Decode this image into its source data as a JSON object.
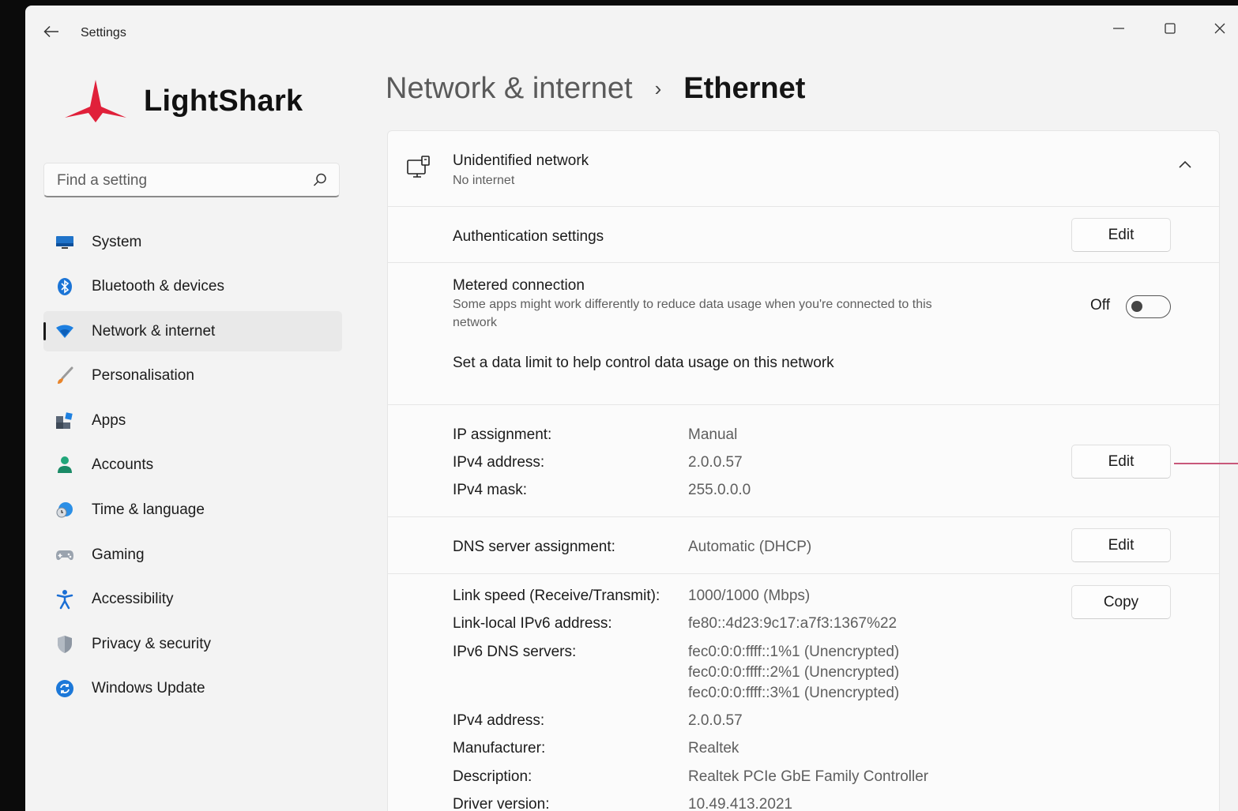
{
  "window": {
    "title": "Settings"
  },
  "brand": {
    "name": "LightShark",
    "color": "#e0203a"
  },
  "search": {
    "placeholder": "Find a setting"
  },
  "nav": {
    "items": [
      {
        "label": "System",
        "icon": "monitor-icon"
      },
      {
        "label": "Bluetooth & devices",
        "icon": "bluetooth-icon"
      },
      {
        "label": "Network & internet",
        "icon": "wifi-icon",
        "active": true
      },
      {
        "label": "Personalisation",
        "icon": "brush-icon"
      },
      {
        "label": "Apps",
        "icon": "apps-icon"
      },
      {
        "label": "Accounts",
        "icon": "person-icon"
      },
      {
        "label": "Time & language",
        "icon": "clock-globe-icon"
      },
      {
        "label": "Gaming",
        "icon": "gamepad-icon"
      },
      {
        "label": "Accessibility",
        "icon": "accessibility-icon"
      },
      {
        "label": "Privacy & security",
        "icon": "shield-icon"
      },
      {
        "label": "Windows Update",
        "icon": "refresh-icon"
      }
    ]
  },
  "header": {
    "parent": "Network & internet",
    "separator": "›",
    "current": "Ethernet"
  },
  "network": {
    "name": "Unidentified network",
    "status": "No internet"
  },
  "auth": {
    "label": "Authentication settings",
    "button": "Edit"
  },
  "metered": {
    "title": "Metered connection",
    "description_line1": "Some apps might work differently to reduce data usage when you're connected to this",
    "description_line2": "network",
    "toggle_label": "Off",
    "toggle_on": false,
    "data_limit_link": "Set a data limit to help control data usage on this network"
  },
  "ip": {
    "assignment_label": "IP assignment:",
    "assignment_value": "Manual",
    "ipv4_label": "IPv4 address:",
    "ipv4_value": "2.0.0.57",
    "mask_label": "IPv4 mask:",
    "mask_value": "255.0.0.0",
    "button": "Edit"
  },
  "dns": {
    "label": "DNS server assignment:",
    "value": "Automatic (DHCP)",
    "button": "Edit"
  },
  "props": {
    "copy_button": "Copy",
    "link_speed_label": "Link speed (Receive/Transmit):",
    "link_speed_value": "1000/1000 (Mbps)",
    "ipv6_local_label": "Link-local IPv6 address:",
    "ipv6_local_value": "fe80::4d23:9c17:a7f3:1367%22",
    "ipv6_dns_label": "IPv6 DNS servers:",
    "ipv6_dns_1": "fec0:0:0:ffff::1%1 (Unencrypted)",
    "ipv6_dns_2": "fec0:0:0:ffff::2%1 (Unencrypted)",
    "ipv6_dns_3": "fec0:0:0:ffff::3%1 (Unencrypted)",
    "ipv4_label": "IPv4 address:",
    "ipv4_value": "2.0.0.57",
    "manufacturer_label": "Manufacturer:",
    "manufacturer_value": "Realtek",
    "description_label": "Description:",
    "description_value": "Realtek PCIe GbE Family Controller",
    "driver_label": "Driver version:",
    "driver_value": "10.49.413.2021"
  }
}
